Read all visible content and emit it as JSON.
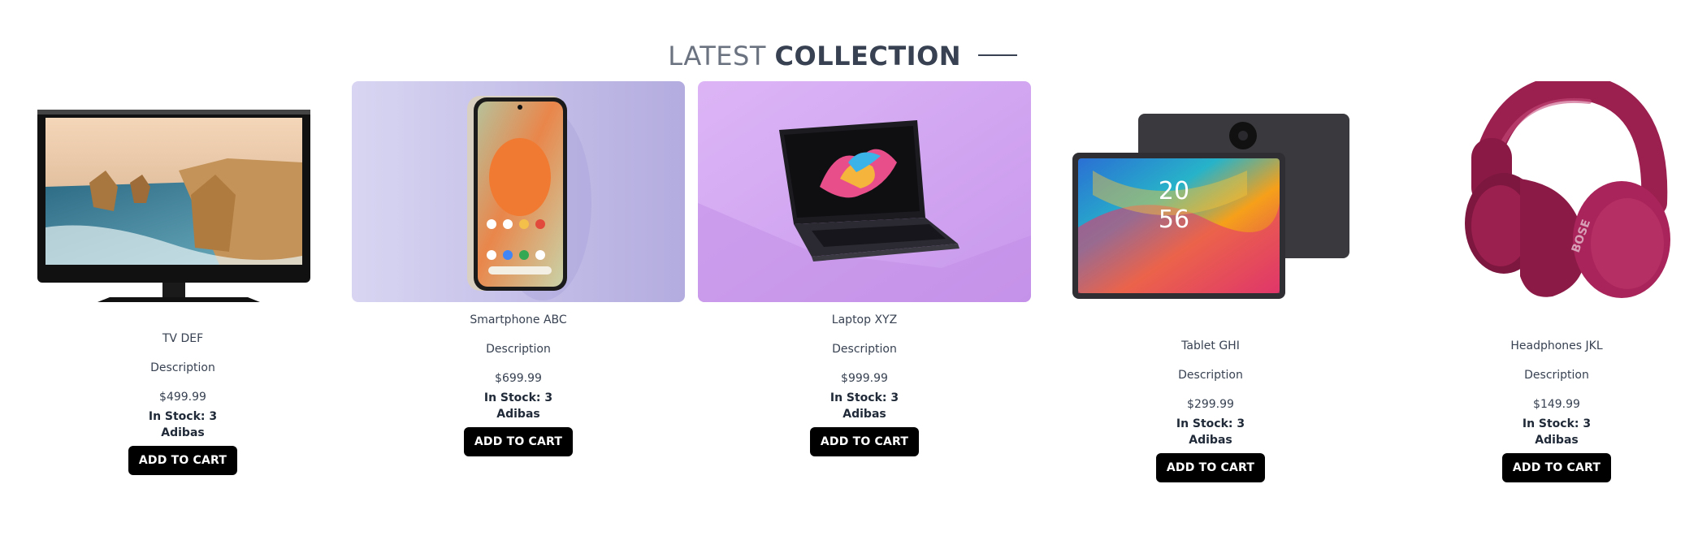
{
  "section": {
    "title_light": "LATEST",
    "title_bold": "COLLECTION"
  },
  "products": [
    {
      "name": "TV DEF",
      "description": "Description",
      "price": "$499.99",
      "stock": "In Stock: 3",
      "brand": "Adibas",
      "button": "ADD TO CART"
    },
    {
      "name": "Smartphone ABC",
      "description": "Description",
      "price": "$699.99",
      "stock": "In Stock: 3",
      "brand": "Adibas",
      "button": "ADD TO CART"
    },
    {
      "name": "Laptop XYZ",
      "description": "Description",
      "price": "$999.99",
      "stock": "In Stock: 3",
      "brand": "Adibas",
      "button": "ADD TO CART"
    },
    {
      "name": "Tablet GHI",
      "description": "Description",
      "price": "$299.99",
      "stock": "In Stock: 3",
      "brand": "Adibas",
      "button": "ADD TO CART"
    },
    {
      "name": "Headphones JKL",
      "description": "Description",
      "price": "$149.99",
      "stock": "In Stock: 3",
      "brand": "Adibas",
      "button": "ADD TO CART"
    }
  ],
  "colors": {
    "button_bg": "#000000",
    "button_text": "#ffffff",
    "phone_bg": "#c6c2ea",
    "laptop_bg": "#d5a9f2",
    "headphones": "#9b1f4f"
  },
  "icons": [
    "tv-image",
    "smartphone-image",
    "laptop-image",
    "tablet-image",
    "headphones-image"
  ]
}
